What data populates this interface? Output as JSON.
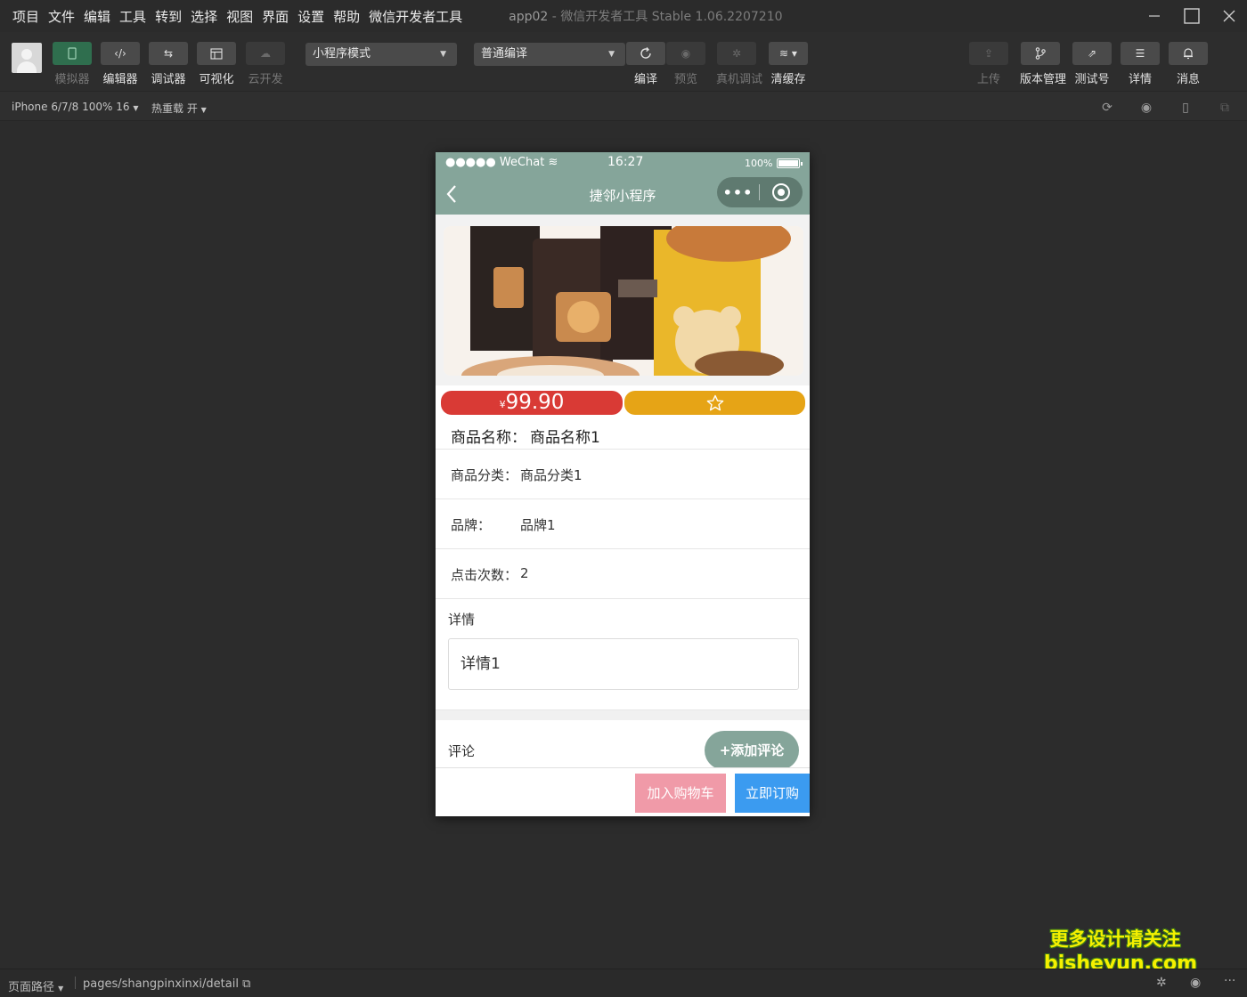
{
  "menubar": {
    "items": [
      "项目",
      "文件",
      "编辑",
      "工具",
      "转到",
      "选择",
      "视图",
      "界面",
      "设置",
      "帮助",
      "微信开发者工具"
    ],
    "app_name": "app02",
    "title_sep": "-",
    "product": "微信开发者工具 Stable 1.06.2207210"
  },
  "toolbar": {
    "simulator": "模拟器",
    "editor": "编辑器",
    "debugger": "调试器",
    "visual": "可视化",
    "cloud": "云开发",
    "mode_select": "小程序模式",
    "compile_select": "普通编译",
    "compile": "编译",
    "preview": "预览",
    "device_debug": "真机调试",
    "clear_cache": "清缓存",
    "upload": "上传",
    "version": "版本管理",
    "test_account": "测试号",
    "details": "详情",
    "messages": "消息"
  },
  "subbar": {
    "device": "iPhone 6/7/8 100% 16",
    "hot_reload": "热重载 开"
  },
  "phone": {
    "carrier": "●●●●● WeChat",
    "time": "16:27",
    "battery": "100%",
    "nav_title": "捷邻小程序",
    "capsule_dots": "•••"
  },
  "product": {
    "currency": "¥",
    "price": "99.90",
    "name_label": "商品名称：",
    "name": "商品名称1",
    "category_label": "商品分类：",
    "category": "商品分类1",
    "brand_label": "品牌：",
    "brand": "品牌1",
    "clicks_label": "点击次数：",
    "clicks": "2",
    "detail_label": "详情",
    "detail": "详情1",
    "comment_label": "评论",
    "add_comment": "+添加评论",
    "add_cart": "加入购物车",
    "buy_now": "立即订购"
  },
  "footbar": {
    "path_label": "页面路径",
    "path": "pages/shangpinxinxi/detail"
  },
  "watermark": {
    "line1": "更多设计请关注",
    "line2": "bisheyun.com"
  },
  "colors": {
    "nav": "#85a59a",
    "price": "#d93a35",
    "favorite": "#e6a416",
    "cart": "#f09aa8",
    "buy": "#3b9bf0"
  },
  "icons": [
    "simulator-icon",
    "code-icon",
    "debug-icon",
    "layout-icon",
    "cloud-icon",
    "refresh-icon",
    "eye-icon",
    "bug-icon",
    "layers-icon",
    "upload-icon",
    "branch-icon",
    "external-icon",
    "menu-icon",
    "bell-icon",
    "star-icon",
    "back-arrow-icon",
    "target-icon"
  ]
}
